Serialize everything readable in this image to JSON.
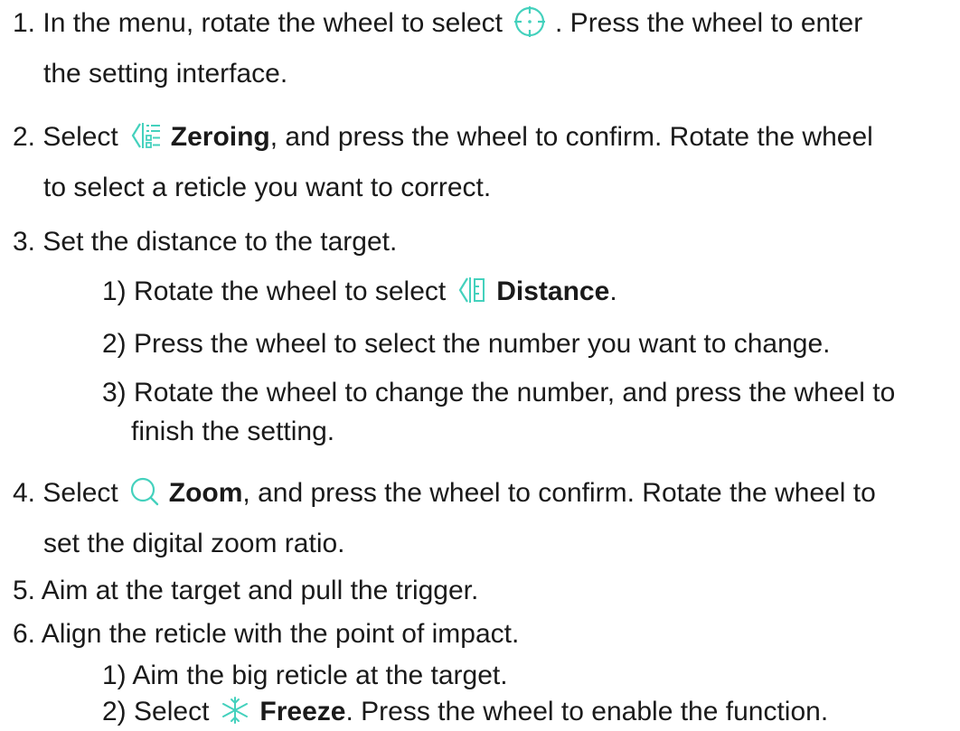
{
  "steps": [
    {
      "num": "1.",
      "pre": "In the menu, rotate the wheel to select",
      "icon": "reticle-crosshair-icon",
      "post": ". Press the wheel to enter",
      "cont": "the setting interface."
    },
    {
      "num": "2.",
      "pre": "Select",
      "icon": "zeroing-icon",
      "bold": "Zeroing",
      "post": ", and press the wheel to confirm. Rotate the wheel",
      "cont": "to select a reticle you want to correct."
    },
    {
      "num": "3.",
      "text": "Set the distance to the target.",
      "substeps": [
        {
          "num": "1)",
          "pre": "Rotate the wheel to select",
          "icon": "distance-icon",
          "bold": "Distance",
          "post": "."
        },
        {
          "num": "2)",
          "text": "Press the wheel to select the number you want to change."
        },
        {
          "num": "3)",
          "text": "Rotate the wheel to change the number, and press the wheel to",
          "cont": "finish the setting."
        }
      ]
    },
    {
      "num": "4.",
      "pre": "Select",
      "icon": "zoom-icon",
      "bold": "Zoom",
      "post": ", and press the wheel to confirm. Rotate the wheel to",
      "cont": "set the digital zoom ratio."
    },
    {
      "num": "5.",
      "text": "Aim at the target and pull the trigger."
    },
    {
      "num": "6.",
      "text": "Align the reticle with the point of impact.",
      "substeps": [
        {
          "num": "1)",
          "text": "Aim the big reticle at the target."
        },
        {
          "num": "2)",
          "pre": "Select",
          "icon": "freeze-icon",
          "bold": "Freeze",
          "post": ". Press the wheel to enable the function."
        }
      ]
    }
  ],
  "colors": {
    "accent": "#44d1bd",
    "text": "#1a1a1a"
  }
}
